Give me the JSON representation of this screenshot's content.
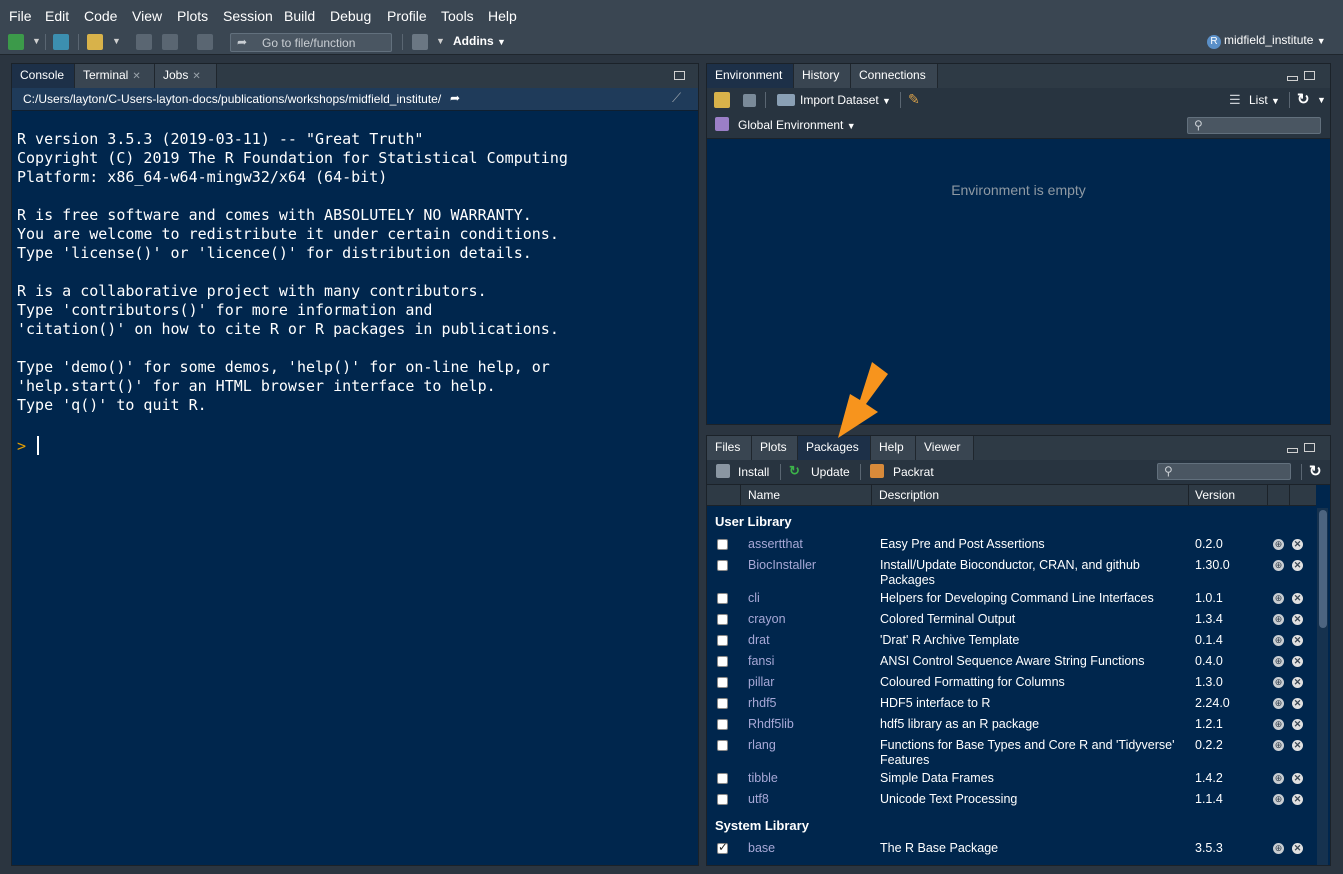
{
  "menu": [
    "File",
    "Edit",
    "Code",
    "View",
    "Plots",
    "Session",
    "Build",
    "Debug",
    "Profile",
    "Tools",
    "Help"
  ],
  "toolbar": {
    "goto_placeholder": "Go to file/function",
    "addins_label": "Addins",
    "project_label": "midfield_institute",
    "project_badge": "R"
  },
  "console": {
    "tabs": [
      {
        "label": "Console"
      },
      {
        "label": "Terminal"
      },
      {
        "label": "Jobs"
      }
    ],
    "path": "C:/Users/layton/C-Users-layton-docs/publications/workshops/midfield_institute/",
    "text": "R version 3.5.3 (2019-03-11) -- \"Great Truth\"\nCopyright (C) 2019 The R Foundation for Statistical Computing\nPlatform: x86_64-w64-mingw32/x64 (64-bit)\n\nR is free software and comes with ABSOLUTELY NO WARRANTY.\nYou are welcome to redistribute it under certain conditions.\nType 'license()' or 'licence()' for distribution details.\n\nR is a collaborative project with many contributors.\nType 'contributors()' for more information and\n'citation()' on how to cite R or R packages in publications.\n\nType 'demo()' for some demos, 'help()' for on-line help, or\n'help.start()' for an HTML browser interface to help.\nType 'q()' to quit R.",
    "prompt": ">"
  },
  "environment": {
    "tabs": [
      {
        "label": "Environment"
      },
      {
        "label": "History"
      },
      {
        "label": "Connections"
      }
    ],
    "import_label": "Import Dataset",
    "list_label": "List",
    "scope_label": "Global Environment",
    "empty_message": "Environment is empty"
  },
  "packages": {
    "tabs": [
      {
        "label": "Files"
      },
      {
        "label": "Plots"
      },
      {
        "label": "Packages"
      },
      {
        "label": "Help"
      },
      {
        "label": "Viewer"
      }
    ],
    "install_label": "Install",
    "update_label": "Update",
    "packrat_label": "Packrat",
    "columns": {
      "name": "Name",
      "description": "Description",
      "version": "Version"
    },
    "user_section": "User Library",
    "system_section": "System Library",
    "user_rows": [
      {
        "name": "assertthat",
        "description": "Easy Pre and Post Assertions",
        "version": "0.2.0",
        "checked": false
      },
      {
        "name": "BiocInstaller",
        "description": "Install/Update Bioconductor, CRAN, and github Packages",
        "version": "1.30.0",
        "checked": false
      },
      {
        "name": "cli",
        "description": "Helpers for Developing Command Line Interfaces",
        "version": "1.0.1",
        "checked": false
      },
      {
        "name": "crayon",
        "description": "Colored Terminal Output",
        "version": "1.3.4",
        "checked": false
      },
      {
        "name": "drat",
        "description": "'Drat' R Archive Template",
        "version": "0.1.4",
        "checked": false
      },
      {
        "name": "fansi",
        "description": "ANSI Control Sequence Aware String Functions",
        "version": "0.4.0",
        "checked": false
      },
      {
        "name": "pillar",
        "description": "Coloured Formatting for Columns",
        "version": "1.3.0",
        "checked": false
      },
      {
        "name": "rhdf5",
        "description": "HDF5 interface to R",
        "version": "2.24.0",
        "checked": false
      },
      {
        "name": "Rhdf5lib",
        "description": "hdf5 library as an R package",
        "version": "1.2.1",
        "checked": false
      },
      {
        "name": "rlang",
        "description": "Functions for Base Types and Core R and 'Tidyverse' Features",
        "version": "0.2.2",
        "checked": false
      },
      {
        "name": "tibble",
        "description": "Simple Data Frames",
        "version": "1.4.2",
        "checked": false
      },
      {
        "name": "utf8",
        "description": "Unicode Text Processing",
        "version": "1.1.4",
        "checked": false
      }
    ],
    "system_rows": [
      {
        "name": "base",
        "description": "The R Base Package",
        "version": "3.5.3",
        "checked": true
      }
    ]
  },
  "colors": {
    "accent": "#f7941d",
    "console_bg": "#00264d",
    "prompt": "#e69f00"
  }
}
